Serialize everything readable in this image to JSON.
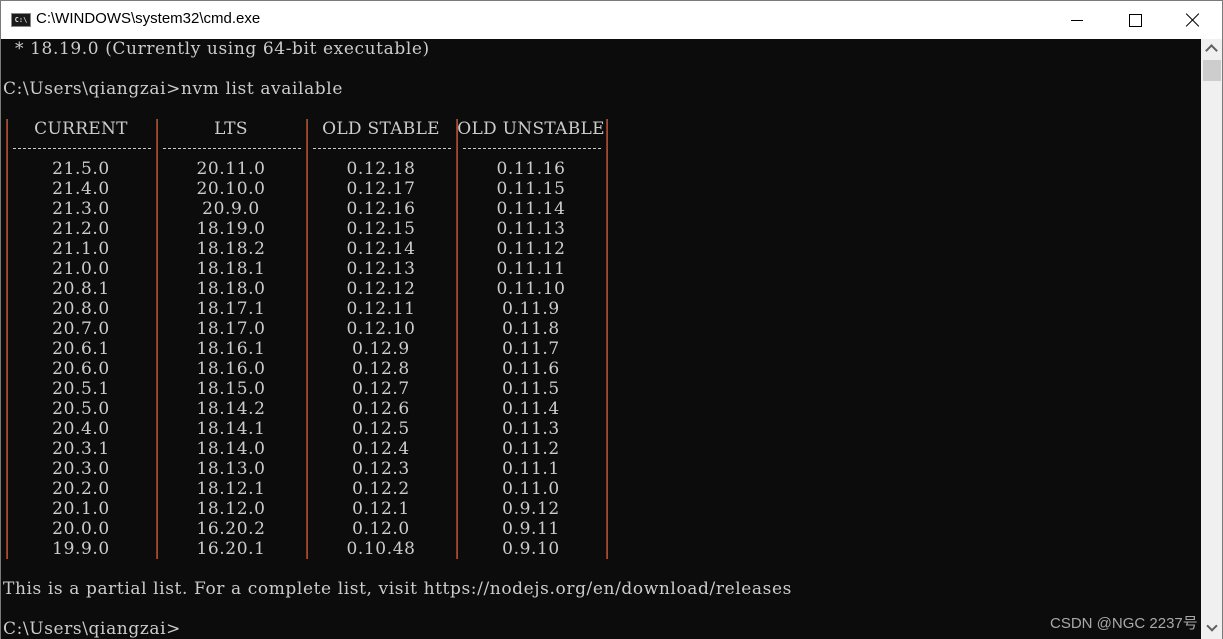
{
  "window": {
    "title": "C:\\WINDOWS\\system32\\cmd.exe",
    "icon": "cmd-icon",
    "icon_text": "C:\\",
    "controls": [
      "minimize-icon",
      "maximize-icon",
      "close-icon"
    ]
  },
  "console": {
    "current_version_line": "  * 18.19.0 (Currently using 64-bit executable)",
    "command_line": "C:\\Users\\qiangzai>nvm list available",
    "table": {
      "headers": [
        "CURRENT",
        "LTS",
        "OLD STABLE",
        "OLD UNSTABLE"
      ],
      "columns": [
        [
          "21.5.0",
          "21.4.0",
          "21.3.0",
          "21.2.0",
          "21.1.0",
          "21.0.0",
          "20.8.1",
          "20.8.0",
          "20.7.0",
          "20.6.1",
          "20.6.0",
          "20.5.1",
          "20.5.0",
          "20.4.0",
          "20.3.1",
          "20.3.0",
          "20.2.0",
          "20.1.0",
          "20.0.0",
          "19.9.0"
        ],
        [
          "20.11.0",
          "20.10.0",
          "20.9.0",
          "18.19.0",
          "18.18.2",
          "18.18.1",
          "18.18.0",
          "18.17.1",
          "18.17.0",
          "18.16.1",
          "18.16.0",
          "18.15.0",
          "18.14.2",
          "18.14.1",
          "18.14.0",
          "18.13.0",
          "18.12.1",
          "18.12.0",
          "16.20.2",
          "16.20.1"
        ],
        [
          "0.12.18",
          "0.12.17",
          "0.12.16",
          "0.12.15",
          "0.12.14",
          "0.12.13",
          "0.12.12",
          "0.12.11",
          "0.12.10",
          "0.12.9",
          "0.12.8",
          "0.12.7",
          "0.12.6",
          "0.12.5",
          "0.12.4",
          "0.12.3",
          "0.12.2",
          "0.12.1",
          "0.12.0",
          "0.10.48"
        ],
        [
          "0.11.16",
          "0.11.15",
          "0.11.14",
          "0.11.13",
          "0.11.12",
          "0.11.11",
          "0.11.10",
          "0.11.9",
          "0.11.8",
          "0.11.7",
          "0.11.6",
          "0.11.5",
          "0.11.4",
          "0.11.3",
          "0.11.2",
          "0.11.1",
          "0.11.0",
          "0.9.12",
          "0.9.11",
          "0.9.10"
        ]
      ]
    },
    "partial_list_line": "This is a partial list. For a complete list, visit https://nodejs.org/en/download/releases",
    "prompt_line": "C:\\Users\\qiangzai>"
  },
  "watermark": "CSDN @NGC 2237号",
  "colors": {
    "console_bg": "#0c0c0c",
    "console_fg": "#cccccc",
    "titlebar_bg": "#ffffff",
    "scrollbar_bg": "#f0f0f0"
  }
}
